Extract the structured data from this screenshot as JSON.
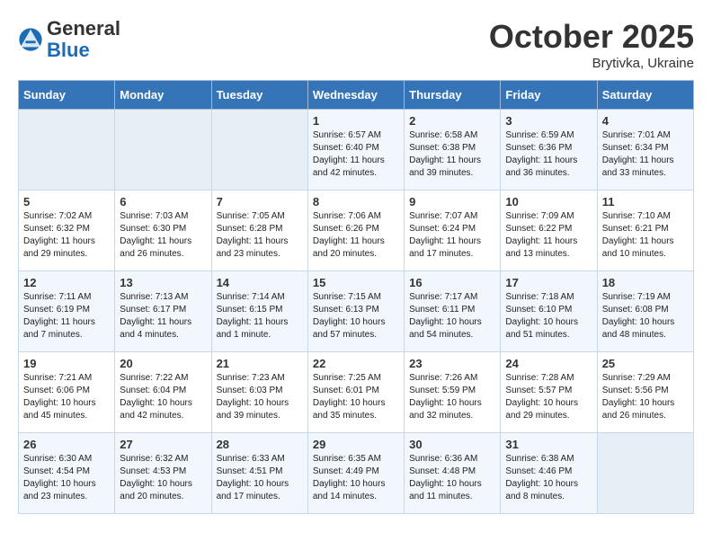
{
  "header": {
    "logo_general": "General",
    "logo_blue": "Blue",
    "month": "October 2025",
    "location": "Brytivka, Ukraine"
  },
  "weekdays": [
    "Sunday",
    "Monday",
    "Tuesday",
    "Wednesday",
    "Thursday",
    "Friday",
    "Saturday"
  ],
  "weeks": [
    [
      {
        "day": "",
        "info": ""
      },
      {
        "day": "",
        "info": ""
      },
      {
        "day": "",
        "info": ""
      },
      {
        "day": "1",
        "info": "Sunrise: 6:57 AM\nSunset: 6:40 PM\nDaylight: 11 hours\nand 42 minutes."
      },
      {
        "day": "2",
        "info": "Sunrise: 6:58 AM\nSunset: 6:38 PM\nDaylight: 11 hours\nand 39 minutes."
      },
      {
        "day": "3",
        "info": "Sunrise: 6:59 AM\nSunset: 6:36 PM\nDaylight: 11 hours\nand 36 minutes."
      },
      {
        "day": "4",
        "info": "Sunrise: 7:01 AM\nSunset: 6:34 PM\nDaylight: 11 hours\nand 33 minutes."
      }
    ],
    [
      {
        "day": "5",
        "info": "Sunrise: 7:02 AM\nSunset: 6:32 PM\nDaylight: 11 hours\nand 29 minutes."
      },
      {
        "day": "6",
        "info": "Sunrise: 7:03 AM\nSunset: 6:30 PM\nDaylight: 11 hours\nand 26 minutes."
      },
      {
        "day": "7",
        "info": "Sunrise: 7:05 AM\nSunset: 6:28 PM\nDaylight: 11 hours\nand 23 minutes."
      },
      {
        "day": "8",
        "info": "Sunrise: 7:06 AM\nSunset: 6:26 PM\nDaylight: 11 hours\nand 20 minutes."
      },
      {
        "day": "9",
        "info": "Sunrise: 7:07 AM\nSunset: 6:24 PM\nDaylight: 11 hours\nand 17 minutes."
      },
      {
        "day": "10",
        "info": "Sunrise: 7:09 AM\nSunset: 6:22 PM\nDaylight: 11 hours\nand 13 minutes."
      },
      {
        "day": "11",
        "info": "Sunrise: 7:10 AM\nSunset: 6:21 PM\nDaylight: 11 hours\nand 10 minutes."
      }
    ],
    [
      {
        "day": "12",
        "info": "Sunrise: 7:11 AM\nSunset: 6:19 PM\nDaylight: 11 hours\nand 7 minutes."
      },
      {
        "day": "13",
        "info": "Sunrise: 7:13 AM\nSunset: 6:17 PM\nDaylight: 11 hours\nand 4 minutes."
      },
      {
        "day": "14",
        "info": "Sunrise: 7:14 AM\nSunset: 6:15 PM\nDaylight: 11 hours\nand 1 minute."
      },
      {
        "day": "15",
        "info": "Sunrise: 7:15 AM\nSunset: 6:13 PM\nDaylight: 10 hours\nand 57 minutes."
      },
      {
        "day": "16",
        "info": "Sunrise: 7:17 AM\nSunset: 6:11 PM\nDaylight: 10 hours\nand 54 minutes."
      },
      {
        "day": "17",
        "info": "Sunrise: 7:18 AM\nSunset: 6:10 PM\nDaylight: 10 hours\nand 51 minutes."
      },
      {
        "day": "18",
        "info": "Sunrise: 7:19 AM\nSunset: 6:08 PM\nDaylight: 10 hours\nand 48 minutes."
      }
    ],
    [
      {
        "day": "19",
        "info": "Sunrise: 7:21 AM\nSunset: 6:06 PM\nDaylight: 10 hours\nand 45 minutes."
      },
      {
        "day": "20",
        "info": "Sunrise: 7:22 AM\nSunset: 6:04 PM\nDaylight: 10 hours\nand 42 minutes."
      },
      {
        "day": "21",
        "info": "Sunrise: 7:23 AM\nSunset: 6:03 PM\nDaylight: 10 hours\nand 39 minutes."
      },
      {
        "day": "22",
        "info": "Sunrise: 7:25 AM\nSunset: 6:01 PM\nDaylight: 10 hours\nand 35 minutes."
      },
      {
        "day": "23",
        "info": "Sunrise: 7:26 AM\nSunset: 5:59 PM\nDaylight: 10 hours\nand 32 minutes."
      },
      {
        "day": "24",
        "info": "Sunrise: 7:28 AM\nSunset: 5:57 PM\nDaylight: 10 hours\nand 29 minutes."
      },
      {
        "day": "25",
        "info": "Sunrise: 7:29 AM\nSunset: 5:56 PM\nDaylight: 10 hours\nand 26 minutes."
      }
    ],
    [
      {
        "day": "26",
        "info": "Sunrise: 6:30 AM\nSunset: 4:54 PM\nDaylight: 10 hours\nand 23 minutes."
      },
      {
        "day": "27",
        "info": "Sunrise: 6:32 AM\nSunset: 4:53 PM\nDaylight: 10 hours\nand 20 minutes."
      },
      {
        "day": "28",
        "info": "Sunrise: 6:33 AM\nSunset: 4:51 PM\nDaylight: 10 hours\nand 17 minutes."
      },
      {
        "day": "29",
        "info": "Sunrise: 6:35 AM\nSunset: 4:49 PM\nDaylight: 10 hours\nand 14 minutes."
      },
      {
        "day": "30",
        "info": "Sunrise: 6:36 AM\nSunset: 4:48 PM\nDaylight: 10 hours\nand 11 minutes."
      },
      {
        "day": "31",
        "info": "Sunrise: 6:38 AM\nSunset: 4:46 PM\nDaylight: 10 hours\nand 8 minutes."
      },
      {
        "day": "",
        "info": ""
      }
    ]
  ]
}
